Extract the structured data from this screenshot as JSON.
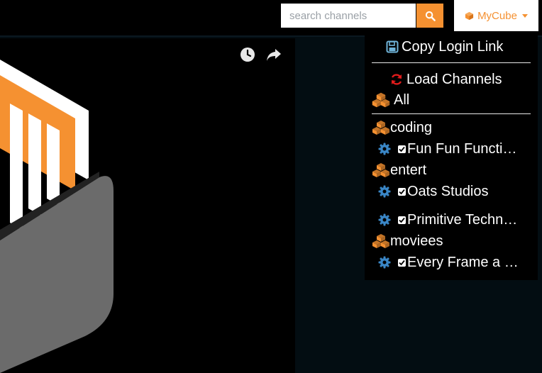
{
  "topbar": {
    "search": {
      "placeholder": "search channels",
      "value": ""
    },
    "search_button_icon": "search-icon",
    "account_menu": {
      "label": "MyCube",
      "icon": "cube-icon"
    }
  },
  "video": {
    "controls": [
      "clock-icon",
      "share-icon"
    ]
  },
  "menu": {
    "copy_login_link": "Copy Login Link",
    "load_channels": "Load Channels",
    "all": "All",
    "groups": [
      {
        "name": "coding",
        "channels": [
          {
            "label": "Fun Fun Functi…",
            "checked": true
          }
        ]
      },
      {
        "name": "entert",
        "channels": [
          {
            "label": "Oats Studios",
            "checked": true
          },
          {
            "label": "Primitive Techn…",
            "checked": true
          }
        ]
      },
      {
        "name": "moviees",
        "channels": [
          {
            "label": "Every Frame a …",
            "checked": true
          }
        ]
      }
    ]
  },
  "colors": {
    "accent": "#f59131",
    "gear": "#3a86c6",
    "save": "#6fb3d8",
    "refresh": "#e21b1b",
    "background": "#030d12"
  }
}
